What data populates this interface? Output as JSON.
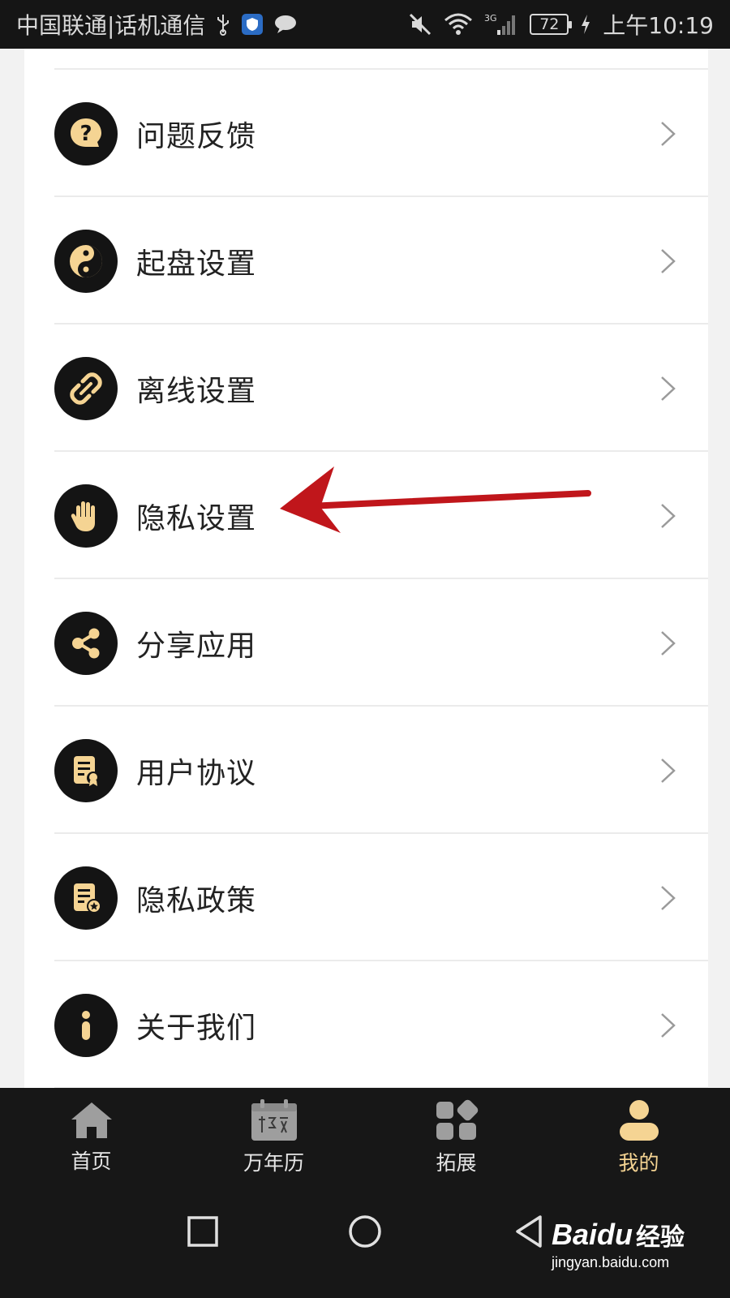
{
  "status_bar": {
    "carrier": "中国联通|话机通信",
    "battery_level": "72",
    "network_type": "3G",
    "time": "上午10:19",
    "icons": [
      "usb-icon",
      "shield-app-icon",
      "message-icon",
      "mute-icon",
      "wifi-icon",
      "signal-icon",
      "battery-icon",
      "charging-icon"
    ]
  },
  "menu": {
    "items": [
      {
        "label": "问题反馈",
        "icon": "question-bubble-icon"
      },
      {
        "label": "起盘设置",
        "icon": "yin-yang-icon"
      },
      {
        "label": "离线设置",
        "icon": "broken-link-icon"
      },
      {
        "label": "隐私设置",
        "icon": "hand-icon"
      },
      {
        "label": "分享应用",
        "icon": "share-icon"
      },
      {
        "label": "用户协议",
        "icon": "certificate-document-icon"
      },
      {
        "label": "隐私政策",
        "icon": "policy-document-icon"
      },
      {
        "label": "关于我们",
        "icon": "info-icon"
      }
    ]
  },
  "tab_bar": {
    "tabs": [
      {
        "label": "首页",
        "icon": "home-icon",
        "active": false
      },
      {
        "label": "万年历",
        "icon": "calendar-icon",
        "active": false
      },
      {
        "label": "拓展",
        "icon": "apps-grid-icon",
        "active": false
      },
      {
        "label": "我的",
        "icon": "user-icon",
        "active": true
      }
    ]
  },
  "system_nav": {
    "buttons": [
      "recent-apps-icon",
      "home-circle-icon",
      "back-triangle-icon"
    ]
  },
  "watermark": {
    "logo": "Baidu",
    "word": "经验",
    "url": "jingyan.baidu.com"
  },
  "colors": {
    "accent_gold": "#f5d493",
    "icon_bg": "#141414",
    "annotation_red": "#c0161b"
  }
}
